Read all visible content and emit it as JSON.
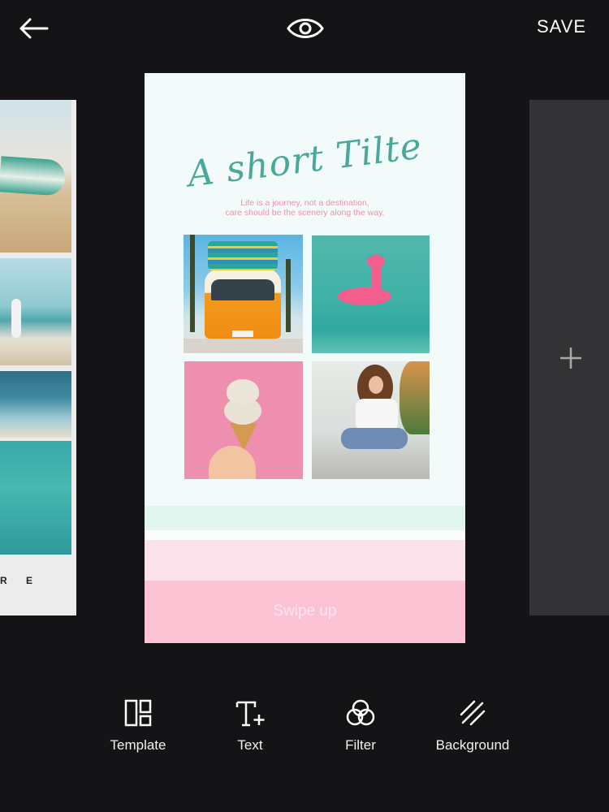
{
  "header": {
    "save_label": "SAVE",
    "back_icon": "arrow-left-icon",
    "preview_icon": "eye-icon"
  },
  "left_card": {
    "bottom_text": "R E"
  },
  "right_card": {
    "add_icon": "plus-icon"
  },
  "story": {
    "title": "A short Tilte",
    "subtitle_line1": "Life is a journey, not a destination,",
    "subtitle_line2": "care should be the scenery along the way.",
    "swipe_label": "Swipe up",
    "photos": [
      "van-photo",
      "flamingo-float-photo",
      "ice-cream-photo",
      "girl-sitting-photo"
    ],
    "colors": {
      "title": "#4aa89a",
      "subtitle": "#ef8fa8",
      "band_mint": "#e2f5ef",
      "band_light_pink": "#fce2ea",
      "band_pink": "#fcc3d4"
    }
  },
  "toolbar": {
    "template_label": "Template",
    "text_label": "Text",
    "filter_label": "Filter",
    "background_label": "Background",
    "icons": [
      "template-icon",
      "text-plus-icon",
      "filter-circles-icon",
      "background-stripes-icon"
    ]
  },
  "colors": {
    "app_background": "#141416",
    "side_card": "#333335"
  }
}
